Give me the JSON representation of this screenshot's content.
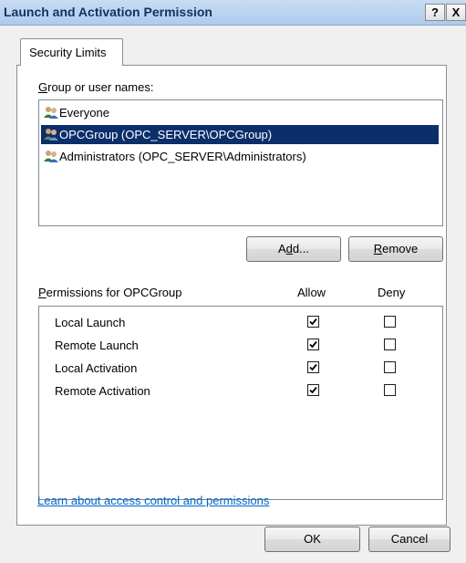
{
  "window": {
    "title": "Launch and Activation Permission"
  },
  "titlebar": {
    "help_label": "?",
    "close_label": "X"
  },
  "tabs": [
    {
      "label": "Security Limits"
    }
  ],
  "group_section": {
    "label_prefix": "G",
    "label_rest": "roup or user names:",
    "users": [
      {
        "name": "Everyone",
        "selected": false
      },
      {
        "name": "OPCGroup (OPC_SERVER\\OPCGroup)",
        "selected": true
      },
      {
        "name": "Administrators (OPC_SERVER\\Administrators)",
        "selected": false
      }
    ],
    "add_button": {
      "pre": "A",
      "accel": "d",
      "post": "d..."
    },
    "remove_button": {
      "accel": "R",
      "post": "emove"
    }
  },
  "permissions_section": {
    "label_prefix": "P",
    "label_rest": "ermissions for OPCGroup",
    "allow_header": "Allow",
    "deny_header": "Deny",
    "rows": [
      {
        "name": "Local Launch",
        "allow": true,
        "deny": false
      },
      {
        "name": "Remote Launch",
        "allow": true,
        "deny": false
      },
      {
        "name": "Local Activation",
        "allow": true,
        "deny": false
      },
      {
        "name": "Remote Activation",
        "allow": true,
        "deny": false
      }
    ]
  },
  "help_link": "Learn about access control and permissions",
  "footer": {
    "ok_label": "OK",
    "cancel_label": "Cancel"
  },
  "colors": {
    "selection": "#0c2e6b",
    "link": "#0066cc"
  },
  "icons": {
    "user": "user-group-icon",
    "check": "checkmark-icon"
  }
}
